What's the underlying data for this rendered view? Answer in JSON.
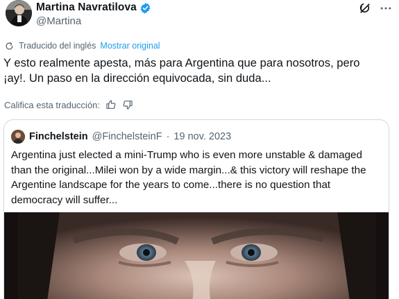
{
  "tweet": {
    "author": {
      "display_name": "Martina Navratilova",
      "handle": "@Martina",
      "verified": true,
      "verified_color": "#1d9bf0"
    },
    "icons": {
      "verified": "verified-badge-icon",
      "grok": "grok-icon",
      "more": "more-options-icon",
      "translate": "translate-icon",
      "like": "thumbs-up-icon",
      "dislike": "thumbs-down-icon"
    },
    "translation": {
      "label": "Traducido del inglés",
      "show_original": "Mostrar original"
    },
    "text_line1": "Y esto realmente apesta, más para Argentina que para nosotros, pero",
    "text_line2": "¡ay!. Un paso en la dirección equivocada, sin duda...",
    "rate_translation": "Califica esta traducción:",
    "quote": {
      "display_name": "Finchelstein",
      "handle": "@FinchelsteinF",
      "separator": "·",
      "date": "19 nov. 2023",
      "text_line1": "Argentina just elected a mini-Trump who is even more unstable & damaged",
      "text_line2": "than the original...Milei won by a wide margin...& this victory will reshape the",
      "text_line3": "Argentine landscape for the years to come...there is no question that",
      "text_line4": "democracy will suffer...",
      "image": "close-up-face-photo"
    }
  },
  "colors": {
    "text_primary": "#0f1419",
    "text_secondary": "#536471",
    "link": "#1d9bf0",
    "border": "#cfd9de"
  }
}
